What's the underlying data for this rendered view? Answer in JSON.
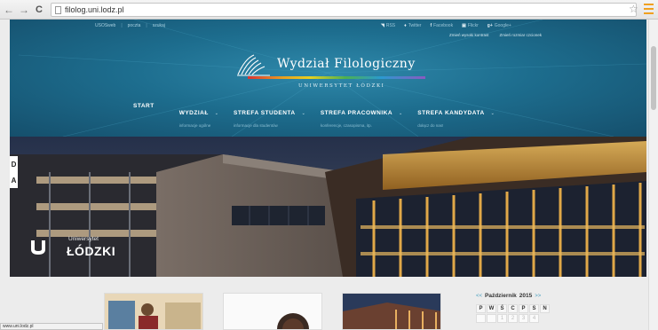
{
  "browser": {
    "back_icon": "arrow-left-icon",
    "forward_icon": "arrow-right-icon",
    "reload_icon": "reload-icon",
    "url": "filolog.uni.lodz.pl",
    "star_icon": "star-icon",
    "menu_icon": "menu-icon",
    "menu_color": "#f0a01f",
    "status_url": "www.uni.lodz.pl"
  },
  "topbar": {
    "links": [
      "USOSweb",
      "poczta",
      "szukaj"
    ],
    "social": [
      {
        "icon": "rss-icon",
        "label": "RSS"
      },
      {
        "icon": "twitter-icon",
        "label": "Twitter"
      },
      {
        "icon": "facebook-icon",
        "label": "Facebook"
      },
      {
        "icon": "flickr-icon",
        "label": "Flickr"
      },
      {
        "icon": "googleplus-icon",
        "label": "Google+"
      }
    ],
    "contrast": [
      "Zmień wysoki kontrast",
      "Zmień rozmiar czcionek"
    ]
  },
  "header": {
    "title": "Wydział Filologiczny",
    "subtitle": "UNIWERSYTET ŁÓDZKI",
    "bg_color": "#1d6d8e"
  },
  "nav": {
    "items": [
      {
        "label": "START",
        "sub": "",
        "has_dropdown": false
      },
      {
        "label": "WYDZIAŁ",
        "sub": "informacje ogólne",
        "has_dropdown": true
      },
      {
        "label": "STREFA STUDENTA",
        "sub": "informacje dla studentów",
        "has_dropdown": true
      },
      {
        "label": "STREFA PRACOWNIKA",
        "sub": "konferencje, czasopisma, itp.",
        "has_dropdown": true
      },
      {
        "label": "STREFA KANDYDATA",
        "sub": "dołącz do nas!",
        "has_dropdown": true
      }
    ]
  },
  "hero": {
    "logo_line1": "Uniwersytet",
    "logo_line2": "ŁÓDZKI",
    "ribbon_letters": [
      "D",
      "A"
    ]
  },
  "calendar": {
    "prev": "<<",
    "month": "Październik",
    "year": "2015",
    "next": ">>",
    "weekdays": [
      "P",
      "W",
      "Ś",
      "C",
      "P",
      "S",
      "N"
    ],
    "first_days": [
      "",
      "",
      "1",
      "2",
      "3",
      "4"
    ]
  }
}
